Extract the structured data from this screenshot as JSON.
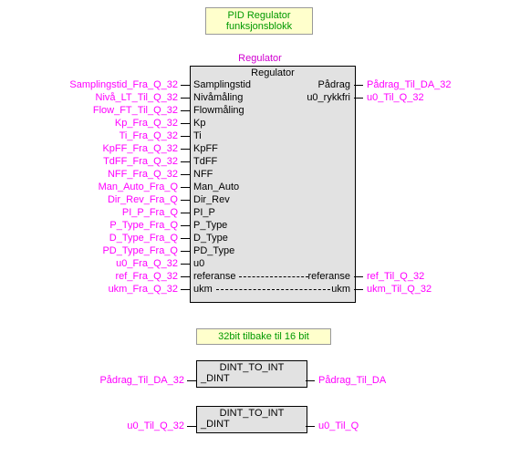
{
  "title1_line1": "PID Regulator",
  "title1_line2": "funksjonsblokk",
  "fb_label": "Regulator",
  "block_header": "Regulator",
  "inputs": [
    {
      "port": "Samplingstid",
      "ext": "Samplingstid_Fra_Q_32"
    },
    {
      "port": "Nivåmåling",
      "ext": "Nivå_LT_Til_Q_32"
    },
    {
      "port": "Flowmåling",
      "ext": "Flow_FT_Til_Q_32"
    },
    {
      "port": "Kp",
      "ext": "Kp_Fra_Q_32"
    },
    {
      "port": "Ti",
      "ext": "Ti_Fra_Q_32"
    },
    {
      "port": "KpFF",
      "ext": "KpFF_Fra_Q_32"
    },
    {
      "port": "TdFF",
      "ext": "TdFF_Fra_Q_32"
    },
    {
      "port": "NFF",
      "ext": "NFF_Fra_Q_32"
    },
    {
      "port": "Man_Auto",
      "ext": "Man_Auto_Fra_Q"
    },
    {
      "port": "Dir_Rev",
      "ext": "Dir_Rev_Fra_Q"
    },
    {
      "port": "PI_P",
      "ext": "PI_P_Fra_Q"
    },
    {
      "port": "P_Type",
      "ext": "P_Type_Fra_Q"
    },
    {
      "port": "D_Type",
      "ext": "D_Type_Fra_Q"
    },
    {
      "port": "PD_Type",
      "ext": "PD_Type_Fra_Q"
    },
    {
      "port": "u0",
      "ext": "u0_Fra_Q_32"
    },
    {
      "port": "referanse",
      "ext": "ref_Fra_Q_32",
      "dashed": true,
      "dash_out": "referanse",
      "ext_out": "ref_Til_Q_32"
    },
    {
      "port": "ukm",
      "ext": "ukm_Fra_Q_32",
      "dashed": true,
      "dash_out": "ukm",
      "ext_out": "ukm_Til_Q_32"
    }
  ],
  "outputs": [
    {
      "port": "Pådrag",
      "ext": "Pådrag_Til_DA_32"
    },
    {
      "port": "u0_rykkfri",
      "ext": "u0_Til_Q_32"
    }
  ],
  "title2": "32bit tilbake til 16 bit",
  "conv": [
    {
      "top": "DINT_TO_INT",
      "port": "_DINT",
      "ext_in": "Pådrag_Til_DA_32",
      "ext_out": "Pådrag_Til_DA"
    },
    {
      "top": "DINT_TO_INT",
      "port": "_DINT",
      "ext_in": "u0_Til_Q_32",
      "ext_out": "u0_Til_Q"
    }
  ]
}
